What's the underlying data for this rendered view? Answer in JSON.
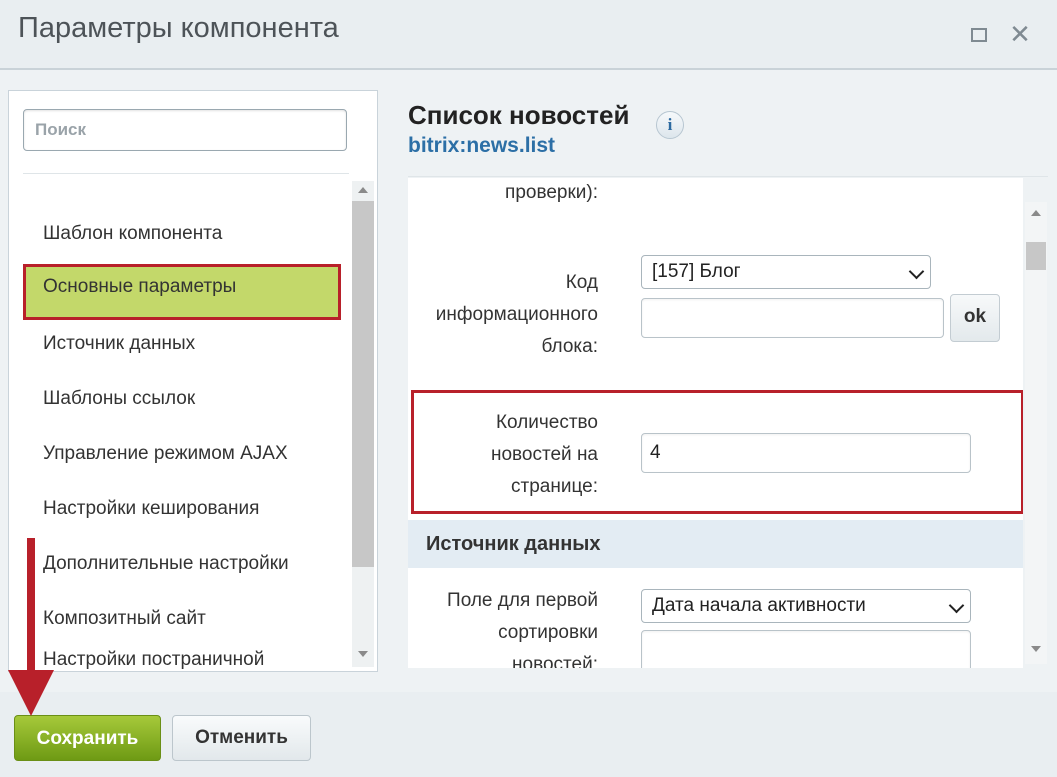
{
  "window": {
    "title": "Параметры компонента",
    "controls": {
      "maximize": "□",
      "close": "✕"
    }
  },
  "sidebar": {
    "search_placeholder": "Поиск",
    "items": [
      {
        "label": "Шаблон компонента",
        "active": false
      },
      {
        "label": "Основные параметры",
        "active": true
      },
      {
        "label": "Источник данных",
        "active": false
      },
      {
        "label": "Шаблоны ссылок",
        "active": false
      },
      {
        "label": "Управление режимом AJAX",
        "active": false
      },
      {
        "label": "Настройки кеширования",
        "active": false
      },
      {
        "label": "Дополнительные настройки",
        "active": false
      },
      {
        "label": "Композитный сайт",
        "active": false
      },
      {
        "label": "Настройки постраничной",
        "active": false
      }
    ]
  },
  "component": {
    "title": "Список новостей",
    "info_icon": "i",
    "code": "bitrix:news.list"
  },
  "params": {
    "check_label_tail": "проверки):",
    "iblock": {
      "label_lines": [
        "Код",
        "информационного",
        "блока:"
      ],
      "select_value": "[157] Блог",
      "input_value": "",
      "ok_label": "ok"
    },
    "news_count": {
      "label_lines": [
        "Количество",
        "новостей на",
        "странице:"
      ],
      "value": "4"
    },
    "data_source_section": "Источник данных",
    "sort1": {
      "label_lines": [
        "Поле для первой",
        "сортировки",
        "новостей:"
      ],
      "select_value": "Дата начала активности",
      "input_value": ""
    }
  },
  "footer": {
    "save_label": "Сохранить",
    "cancel_label": "Отменить"
  },
  "colors": {
    "active_item_bg": "#c3d86a",
    "highlight_border": "#b8202a",
    "save_button": "#8ab628",
    "link_blue": "#2c6fa6",
    "section_bg": "#e3ecf3"
  },
  "icons": {
    "maximize": "maximize-icon",
    "close": "close-icon",
    "info": "info-icon",
    "chevron": "chevron-down-icon",
    "arrow": "down-arrow-annotation"
  }
}
